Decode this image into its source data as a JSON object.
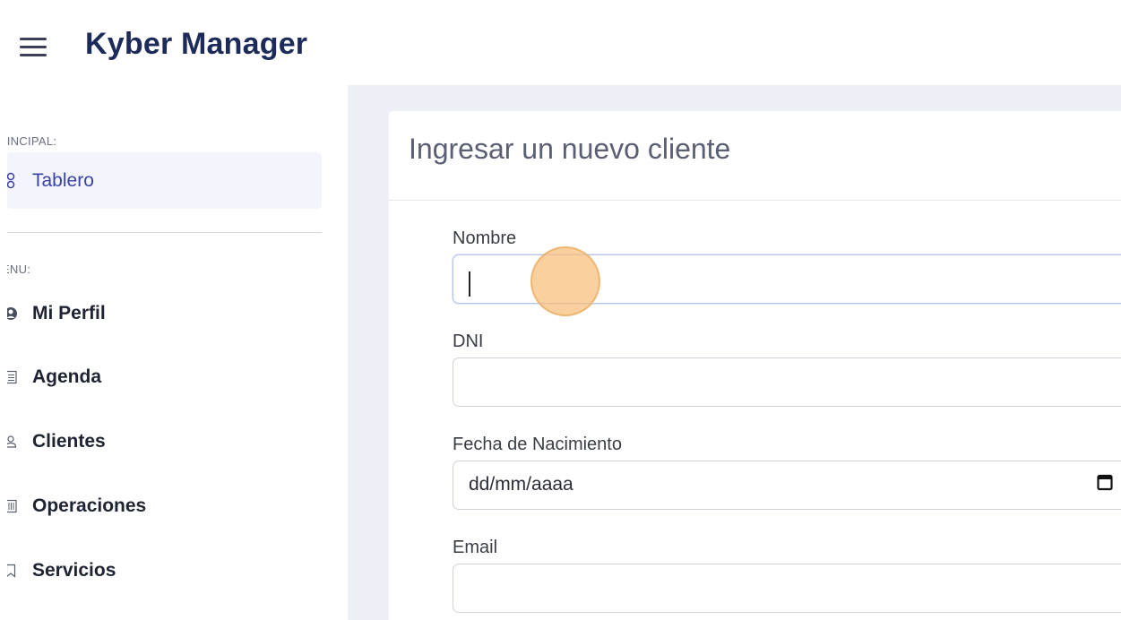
{
  "header": {
    "app_title": "Kyber Manager",
    "menu_icon": "hamburger-icon"
  },
  "sidebar": {
    "principal_heading": "RINCIPAL:",
    "menu_heading": "IENU:",
    "items": [
      {
        "label": "Tablero",
        "icon": "dashboard-icon",
        "active": true
      },
      {
        "label": "Mi Perfil",
        "icon": "profile-icon"
      },
      {
        "label": "Agenda",
        "icon": "calendar-icon"
      },
      {
        "label": "Clientes",
        "icon": "user-icon"
      },
      {
        "label": "Operaciones",
        "icon": "operations-icon"
      },
      {
        "label": "Servicios",
        "icon": "bookmark-icon"
      }
    ]
  },
  "form": {
    "title": "Ingresar un nuevo cliente",
    "fields": [
      {
        "label": "Nombre",
        "value": ""
      },
      {
        "label": "DNI",
        "value": ""
      },
      {
        "label": "Fecha de Nacimiento",
        "value": "dd/mm/aaaa"
      },
      {
        "label": "Email",
        "value": ""
      }
    ]
  },
  "colors": {
    "brand": "#1c2b5a",
    "active_nav_text": "#3842a8",
    "content_background": "#eef0f8",
    "click_indicator": "#f6be78"
  }
}
